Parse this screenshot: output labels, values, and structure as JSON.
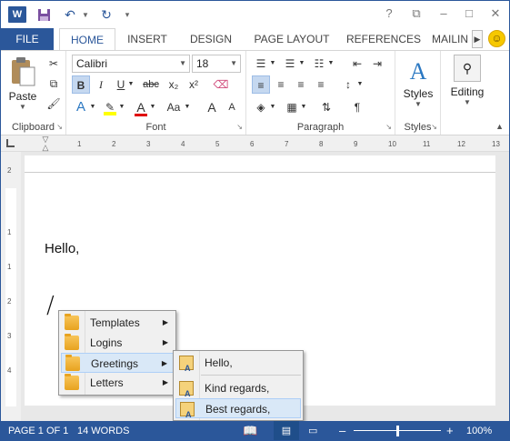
{
  "quick_access": {
    "word_logo": "W",
    "save": "save",
    "undo": "undo",
    "redo": "redo",
    "customize": "customize"
  },
  "window_controls": {
    "help": "?",
    "restore_ribbon": "⧉",
    "minimize": "–",
    "maximize": "□",
    "close": "✕"
  },
  "tabs": {
    "file": "FILE",
    "home": "HOME",
    "insert": "INSERT",
    "design": "DESIGN",
    "page_layout": "PAGE LAYOUT",
    "references": "REFERENCES",
    "mailings": "MAILIN"
  },
  "ribbon": {
    "clipboard": {
      "label": "Clipboard",
      "paste": "Paste"
    },
    "font": {
      "label": "Font",
      "font_name": "Calibri",
      "font_size": "18",
      "bold": "B",
      "italic": "I",
      "underline": "U",
      "strike": "abc",
      "subscript": "x₂",
      "superscript": "x²",
      "grow": "A",
      "shrink": "A",
      "case": "Aa"
    },
    "paragraph": {
      "label": "Paragraph",
      "show_marks": "¶"
    },
    "styles": {
      "label": "Styles",
      "button": "Styles"
    },
    "editing": {
      "button": "Editing"
    }
  },
  "ruler": {
    "h_ticks": [
      "1",
      "2",
      "3",
      "4",
      "5",
      "6",
      "7",
      "8",
      "9",
      "10",
      "11",
      "12",
      "13"
    ],
    "v_ticks": [
      "2",
      "1",
      "1",
      "2",
      "3",
      "4"
    ]
  },
  "document": {
    "greeting": "Hello,",
    "typed_char": "/"
  },
  "menu": {
    "items": [
      {
        "label": "Templates",
        "icon": "folder-icon"
      },
      {
        "label": "Logins",
        "icon": "folder-icon"
      },
      {
        "label": "Greetings",
        "icon": "folder-icon"
      },
      {
        "label": "Letters",
        "icon": "folder-icon"
      }
    ],
    "highlighted": "Greetings"
  },
  "submenu": {
    "items": [
      {
        "label": "Hello,",
        "icon": "snippet-icon"
      },
      {
        "label": "Kind regards,",
        "icon": "snippet-icon"
      },
      {
        "label": "Best regards,",
        "icon": "snippet-icon"
      }
    ],
    "highlighted": "Best regards,"
  },
  "status_bar": {
    "page": "PAGE 1 OF 1",
    "words": "14 WORDS",
    "zoom": "100%",
    "zoom_out": "–",
    "zoom_in": "+"
  },
  "colors": {
    "accent": "#2b579a",
    "highlight_yellow": "#ffff00",
    "font_red": "#e00000"
  }
}
